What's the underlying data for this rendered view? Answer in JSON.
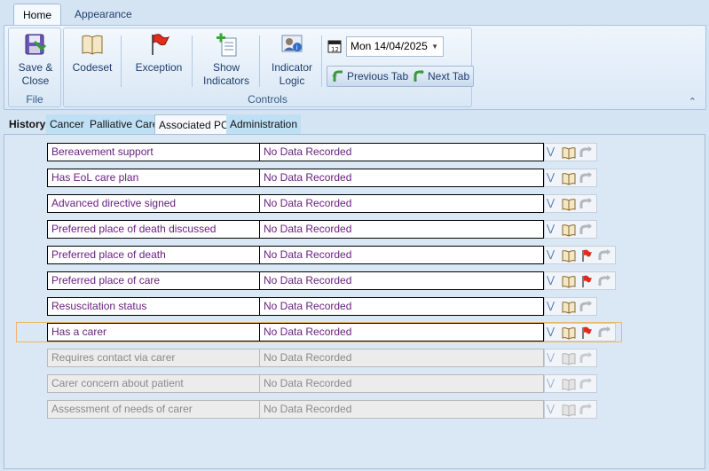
{
  "ribbon_tabs": {
    "home": "Home",
    "appearance": "Appearance"
  },
  "file_group": {
    "label": "File",
    "save_close_l1": "Save &",
    "save_close_l2": "Close"
  },
  "controls_group": {
    "label": "Controls",
    "codeset": "Codeset",
    "exception": "Exception",
    "show_indicators_l1": "Show",
    "show_indicators_l2": "Indicators",
    "indicator_logic_l1": "Indicator",
    "indicator_logic_l2": "Logic",
    "date_value": "Mon 14/04/2025",
    "previous_tab": "Previous Tab",
    "next_tab": "Next Tab"
  },
  "page_tabs": [
    "History",
    "Cancer",
    "Palliative Care",
    "Associated PC",
    "Administration"
  ],
  "rows": [
    {
      "label": "Bereavement support",
      "value": "No Data Recorded"
    },
    {
      "label": "Has EoL care plan",
      "value": "No Data Recorded"
    },
    {
      "label": "Advanced directive signed",
      "value": "No Data Recorded"
    },
    {
      "label": "Preferred place of death discussed",
      "value": "No Data Recorded"
    },
    {
      "label": "Preferred place of death",
      "value": "No Data Recorded"
    },
    {
      "label": "Preferred place of care",
      "value": "No Data Recorded"
    },
    {
      "label": "Resuscitation status",
      "value": "No Data Recorded"
    },
    {
      "label": "Has a carer",
      "value": "No Data Recorded"
    },
    {
      "label": "Requires contact via carer",
      "value": "No Data Recorded"
    },
    {
      "label": "Carer concern about patient",
      "value": "No Data Recorded"
    },
    {
      "label": "Assessment of needs of carer",
      "value": "No Data Recorded"
    }
  ],
  "colors": {
    "row_text": "#6a1f80",
    "focus_outline": "#f0b36a",
    "background": "#dae8f6"
  },
  "icons": [
    "save-disk-icon",
    "codeset-book-icon",
    "exception-flag-icon",
    "show-indicators-icon",
    "indicator-logic-icon",
    "calendar-icon",
    "expand-chevron-icon",
    "book-icon",
    "flag-icon",
    "undo-arrow-icon"
  ]
}
